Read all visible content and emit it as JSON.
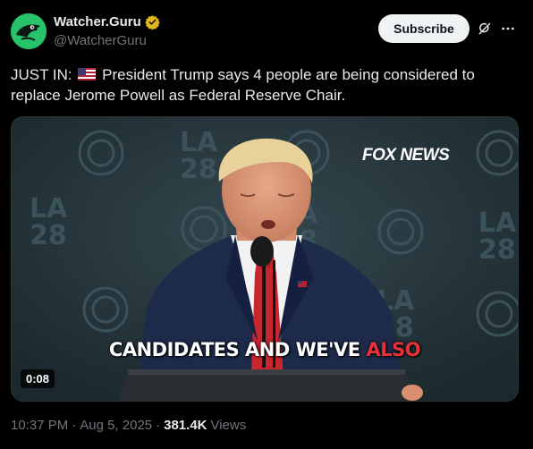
{
  "author": {
    "display_name": "Watcher.Guru",
    "handle": "@WatcherGuru",
    "verified": true,
    "avatar_color": "#27c36a"
  },
  "actions": {
    "subscribe_label": "Subscribe",
    "grok_icon": "grok-icon",
    "more_icon": "more-icon"
  },
  "post": {
    "prefix": "JUST IN:",
    "flag": "us-flag-icon",
    "body": "President Trump says 4 people are being considered to replace Jerome Powell as Federal Reserve Chair."
  },
  "media": {
    "network_logo": "FOX NEWS",
    "caption_main": "CANDIDATES AND WE'VE",
    "caption_highlight": "ALSO",
    "duration": "0:08",
    "backdrop_text": "LA 28"
  },
  "meta": {
    "time": "10:37 PM",
    "date": "Aug 5, 2025",
    "views_count": "381.4K",
    "views_label": "Views",
    "separator": "·"
  },
  "colors": {
    "background": "#000000",
    "text_primary": "#e7e9ea",
    "text_secondary": "#71767b",
    "verified_gold": "#e2b719",
    "caption_highlight": "#e8323a"
  }
}
